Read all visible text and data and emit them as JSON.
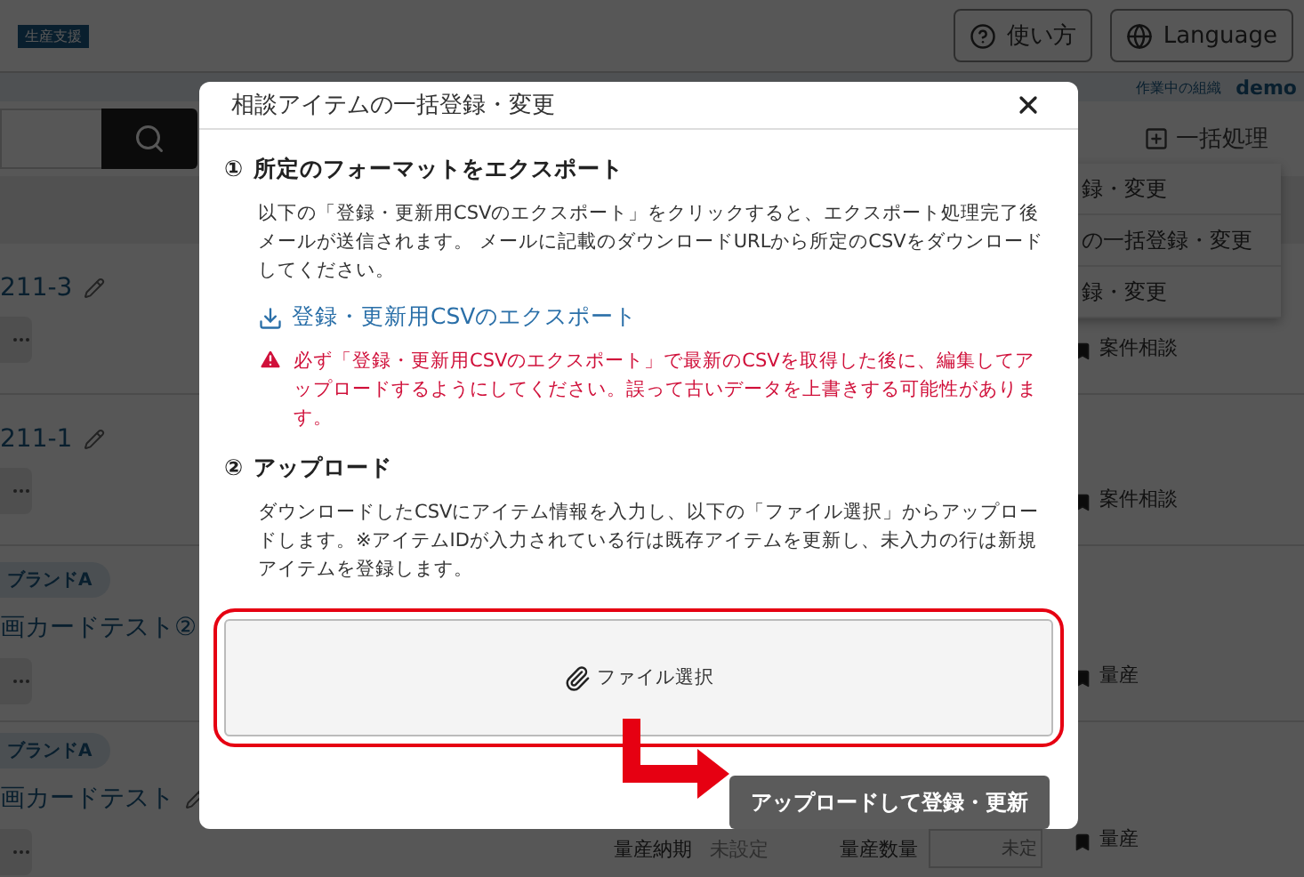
{
  "header": {
    "badge": "生産支援",
    "buttons": [
      {
        "label": "使い方",
        "kind": "help"
      },
      {
        "label": "Language",
        "kind": "globe"
      }
    ]
  },
  "org_bar": {
    "label": "作業中の組織",
    "value": "demo"
  },
  "toolbar": {
    "bulk_action": "一括処理"
  },
  "menu": {
    "items": [
      "録・変更",
      "の一括登録・変更",
      "録・変更"
    ]
  },
  "rows": [
    {
      "title": "211-3",
      "tag": "案件相談"
    },
    {
      "title": "211-1",
      "tag": "案件相談"
    },
    {
      "brand": "ブランドA",
      "title": "画カードテスト②",
      "tag": "量産"
    },
    {
      "brand": "ブランドA",
      "title": "画カードテスト",
      "tag": "量産",
      "fields": [
        {
          "label": "量産納期",
          "value": "未設定"
        },
        {
          "label": "量産数量",
          "placeholder": "未定"
        }
      ]
    }
  ],
  "modal": {
    "title": "相談アイテムの一括登録・変更",
    "sections": [
      {
        "number": "①",
        "heading": "所定のフォーマットをエクスポート",
        "text": "以下の「登録・更新用CSVのエクスポート」をクリックすると、エクスポート処理完了後メールが送信されます。 メールに記載のダウンロードURLから所定のCSVをダウンロードしてください。",
        "link": "登録・更新用CSVのエクスポート",
        "warning": "必ず「登録・更新用CSVのエクスポート」で最新のCSVを取得した後に、編集してアップロードするようにしてください。誤って古いデータを上書きする可能性があります。"
      },
      {
        "number": "②",
        "heading": "アップロード",
        "text": "ダウンロードしたCSVにアイテム情報を入力し、以下の「ファイル選択」からアップロードします。※アイテムIDが入力されている行は既存アイテムを更新し、未入力の行は新規アイテムを登録します。"
      }
    ],
    "file_button": "ファイル選択",
    "submit": "アップロードして登録・更新"
  }
}
